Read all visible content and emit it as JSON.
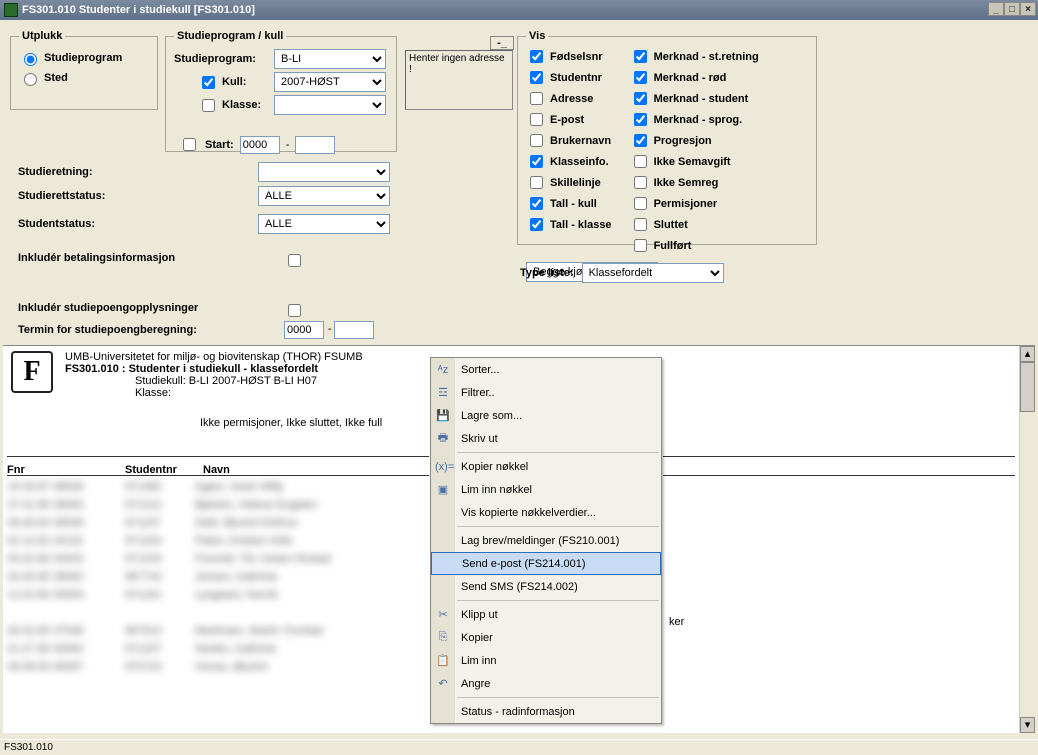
{
  "window": {
    "title": "FS301.010 Studenter i studiekull   [FS301.010]"
  },
  "utplukk": {
    "legend": "Utplukk",
    "studieprogram": "Studieprogram",
    "sted": "Sted"
  },
  "sp": {
    "legend": "Studieprogram / kull",
    "label_sp": "Studieprogram:",
    "value_sp": "B-LI",
    "label_kull": "Kull:",
    "value_kull": "2007-HØST",
    "label_klasse": "Klasse:",
    "value_klasse": ""
  },
  "start": {
    "label": "Start:",
    "year": "0000",
    "term": ""
  },
  "msgbox": {
    "text": "Henter ingen adresse !"
  },
  "midlabels": {
    "studieretning": "Studieretning:",
    "studierett": "Studierettstatus:",
    "studentstatus": "Studentstatus:",
    "betaling": "Inkludér betalingsinformasjon",
    "studiepoeng": "Inkludér studiepoengopplysninger",
    "termin": "Termin for studiepoengberegning:"
  },
  "midvalues": {
    "studierett": "ALLE",
    "studentstatus": "ALLE",
    "termin_year": "0000",
    "termin_term": ""
  },
  "vis": {
    "legend": "Vis",
    "left": [
      {
        "label": "Fødselsnr",
        "checked": true
      },
      {
        "label": "Studentnr",
        "checked": true
      },
      {
        "label": "Adresse",
        "checked": false
      },
      {
        "label": "E-post",
        "checked": false
      },
      {
        "label": "Brukernavn",
        "checked": false
      },
      {
        "label": "Klasseinfo.",
        "checked": true
      },
      {
        "label": "Skillelinje",
        "checked": false
      },
      {
        "label": "Tall - kull",
        "checked": true
      },
      {
        "label": "Tall - klasse",
        "checked": true
      }
    ],
    "right": [
      {
        "label": "Merknad - st.retning",
        "checked": true
      },
      {
        "label": "Merknad - rød",
        "checked": true
      },
      {
        "label": "Merknad - student",
        "checked": true
      },
      {
        "label": "Merknad - sprog.",
        "checked": true
      },
      {
        "label": "Progresjon",
        "checked": true
      },
      {
        "label": "Ikke Semavgift",
        "checked": false
      },
      {
        "label": "Ikke Semreg",
        "checked": false
      },
      {
        "label": "Permisjoner",
        "checked": false
      },
      {
        "label": "Sluttet",
        "checked": false
      },
      {
        "label": "Fullført",
        "checked": false
      }
    ],
    "gender": "Begge kjønn"
  },
  "typeliste": {
    "label": "Type liste:",
    "value": "Klassefordelt"
  },
  "report": {
    "inst": "UMB-Universitetet for miljø- og biovitenskap (THOR)    FSUMB",
    "title": "FS301.010 : Studenter i studiekull - klassefordelt",
    "studiekull": "Studiekull:  B-LI 2007-HØST B-LI H07",
    "klasse": "Klasse:",
    "filterline": "Ikke permisjoner, Ikke sluttet, Ikke full",
    "colheaders": {
      "fnr": "Fnr",
      "studentnr": "Studentnr",
      "navn": "Navn"
    },
    "rows": [
      {
        "fnr": "15.09.87 48528",
        "snr": "971382",
        "navn": "Agten, Svein Willy"
      },
      {
        "fnr": "27.01.85 39093",
        "snr": "971212",
        "navn": "Bjørken, Helene Engelen"
      },
      {
        "fnr": "09.06.84 36508",
        "snr": "971197",
        "navn": "Dahl, Øyvind Kirkhus"
      },
      {
        "fnr": "02.12.82 44118",
        "snr": "971200",
        "navn": "Flatre, Kristian Hofe"
      },
      {
        "fnr": "03.02.86 34543",
        "snr": "971204",
        "navn": "Fosvold, Tim Josten Rostad"
      },
      {
        "fnr": "03.05.85 38092",
        "snr": "967744",
        "navn": "Jensen, Kathrine"
      },
      {
        "fnr": "12.02.80 30929",
        "snr": "971201",
        "navn": "Lysgaard, Henrik"
      }
    ],
    "rows2": [
      {
        "fnr": "26.02.85 37548",
        "snr": "967913",
        "navn": "Martinsen, Martin Trombal"
      },
      {
        "fnr": "01.07.85 45464",
        "snr": "971207",
        "navn": "Neslen, Kathrine"
      },
      {
        "fnr": "06.08.83 36397",
        "snr": "970723",
        "navn": "Osnes, Øyvind"
      }
    ],
    "note": "ker"
  },
  "ctx": {
    "sorter": "Sorter...",
    "filtrer": "Filtrer..",
    "lagresom": "Lagre som...",
    "skrivut": "Skriv ut",
    "kopier_nokkel": "Kopier nøkkel",
    "liminn_nokkel": "Lim inn nøkkel",
    "vis_nokkel": "Vis kopierte nøkkelverdier...",
    "lagbrev": "Lag brev/meldinger (FS210.001)",
    "sendepost": "Send e-post (FS214.001)",
    "sendsms": "Send SMS (FS214.002)",
    "klipput": "Klipp ut",
    "kopier": "Kopier",
    "liminn": "Lim inn",
    "angre": "Angre",
    "status": "Status - radinformasjon"
  },
  "statusbar": "FS301.010"
}
